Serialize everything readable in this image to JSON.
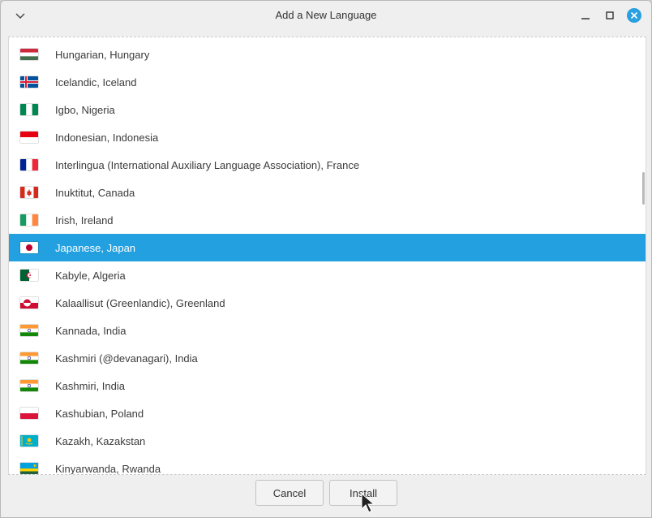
{
  "window": {
    "title": "Add a New Language"
  },
  "titlebar": {
    "collapse_icon": "chevron-down-icon",
    "minimize_icon": "minimize-icon",
    "maximize_icon": "maximize-icon",
    "close_icon": "close-icon",
    "close_color": "#2aa0e0"
  },
  "languages": [
    {
      "label": "Hungarian, Hungary",
      "flag": "hu",
      "selected": false
    },
    {
      "label": "Icelandic, Iceland",
      "flag": "is",
      "selected": false
    },
    {
      "label": "Igbo, Nigeria",
      "flag": "ng",
      "selected": false
    },
    {
      "label": "Indonesian, Indonesia",
      "flag": "id",
      "selected": false
    },
    {
      "label": "Interlingua (International Auxiliary Language Association), France",
      "flag": "fr",
      "selected": false
    },
    {
      "label": "Inuktitut, Canada",
      "flag": "ca",
      "selected": false
    },
    {
      "label": "Irish, Ireland",
      "flag": "ie",
      "selected": false
    },
    {
      "label": "Japanese, Japan",
      "flag": "jp",
      "selected": true
    },
    {
      "label": "Kabyle, Algeria",
      "flag": "dz",
      "selected": false
    },
    {
      "label": "Kalaallisut (Greenlandic), Greenland",
      "flag": "gl",
      "selected": false
    },
    {
      "label": "Kannada, India",
      "flag": "in",
      "selected": false
    },
    {
      "label": "Kashmiri (@devanagari), India",
      "flag": "in",
      "selected": false
    },
    {
      "label": "Kashmiri, India",
      "flag": "in",
      "selected": false
    },
    {
      "label": "Kashubian, Poland",
      "flag": "pl",
      "selected": false
    },
    {
      "label": "Kazakh, Kazakstan",
      "flag": "kz",
      "selected": false
    },
    {
      "label": "Kinyarwanda, Rwanda",
      "flag": "rw",
      "selected": false
    }
  ],
  "selection_color": "#23a0df",
  "buttons": {
    "cancel": "Cancel",
    "install": "Install"
  }
}
